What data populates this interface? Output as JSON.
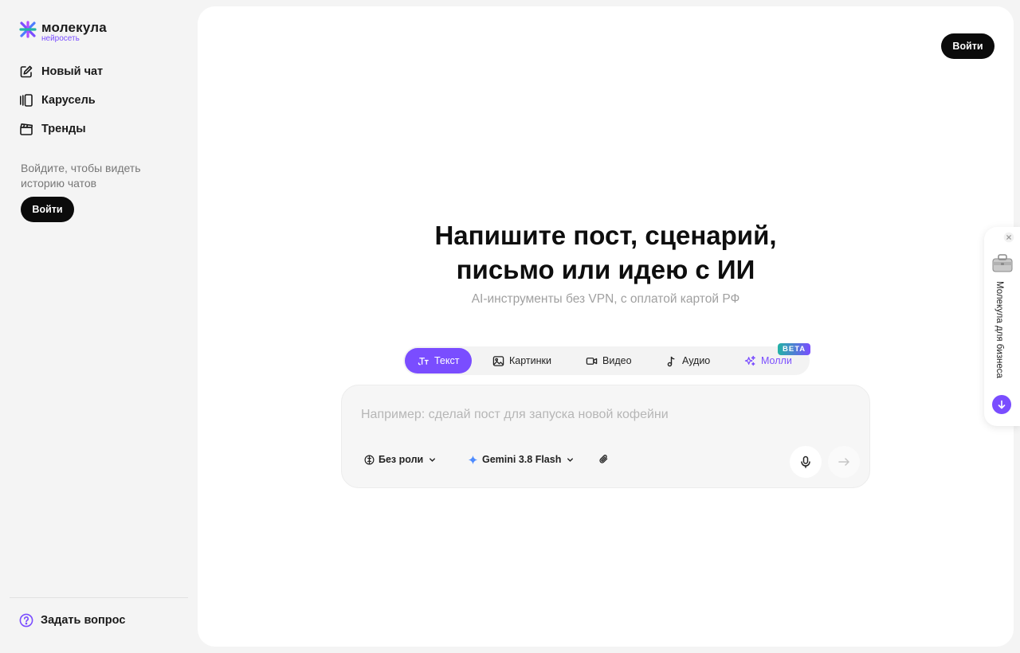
{
  "brand": {
    "name": "молекула",
    "tagline": "нейросеть",
    "accent": "#7a4dff"
  },
  "sidebar": {
    "items": [
      {
        "label": "Новый чат",
        "icon": "edit-icon"
      },
      {
        "label": "Карусель",
        "icon": "carousel-icon"
      },
      {
        "label": "Тренды",
        "icon": "clapperboard-icon"
      }
    ],
    "history_hint": "Войдите, чтобы видеть историю чатов",
    "login_label": "Войти",
    "ask_label": "Задать вопрос"
  },
  "header": {
    "login_label": "Войти"
  },
  "hero": {
    "title_line1": "Напишите пост, сценарий,",
    "title_line2": "письмо или идею с ИИ",
    "subtitle": "AI-инструменты без VPN, с оплатой картой РФ"
  },
  "tabs": [
    {
      "label": "Текст",
      "icon": "text-icon",
      "active": true
    },
    {
      "label": "Картинки",
      "icon": "image-icon",
      "active": false
    },
    {
      "label": "Видео",
      "icon": "video-icon",
      "active": false
    },
    {
      "label": "Аудио",
      "icon": "music-note-icon",
      "active": false
    },
    {
      "label": "Молли",
      "icon": "sparkles-icon",
      "active": false,
      "badge": "BETA"
    }
  ],
  "composer": {
    "placeholder": "Например: сделай пост для запуска новой кофейни",
    "value": "",
    "role_label": "Без роли",
    "model_label": "Gemini 3.8 Flash"
  },
  "promo": {
    "text": "Молекула для бизнеса"
  }
}
